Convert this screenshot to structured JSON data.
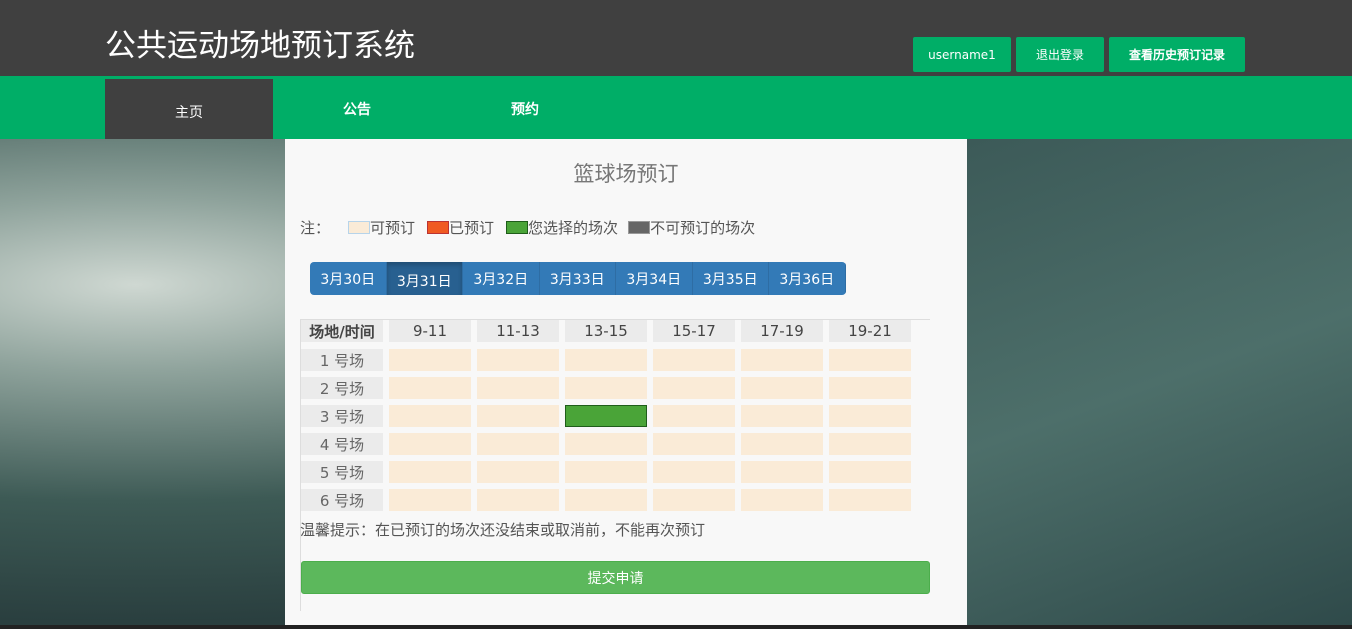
{
  "header": {
    "title": "公共运动场地预订系统",
    "username": "username1",
    "logout": "退出登录",
    "history": "查看历史预订记录"
  },
  "nav": [
    {
      "label": "主页",
      "active": true
    },
    {
      "label": "公告"
    },
    {
      "label": "预约"
    }
  ],
  "panel": {
    "title": "篮球场预订",
    "legend": {
      "prefix": "注：",
      "items": [
        {
          "label": "可预订",
          "color": "#faebd7"
        },
        {
          "label": "已预订",
          "color": "#f05a22"
        },
        {
          "label": "您选择的场次",
          "color": "#4aa438"
        },
        {
          "label": "不可预订的场次",
          "color": "#666666"
        }
      ]
    },
    "dates": [
      "3月30日",
      "3月31日",
      "3月32日",
      "3月33日",
      "3月34日",
      "3月35日",
      "3月36日"
    ],
    "active_date": 1,
    "table": {
      "corner": "场地/时间",
      "times": [
        "9-11",
        "11-13",
        "13-15",
        "15-17",
        "17-19",
        "19-21"
      ],
      "courts": [
        "1 号场",
        "2 号场",
        "3 号场",
        "4 号场",
        "5 号场",
        "6 号场"
      ],
      "selected": [
        {
          "court": "3 号场",
          "time": "13-15"
        }
      ]
    },
    "tip": "温馨提示：在已预订的场次还没结束或取消前，不能再次预订",
    "submit": "提交申请"
  }
}
